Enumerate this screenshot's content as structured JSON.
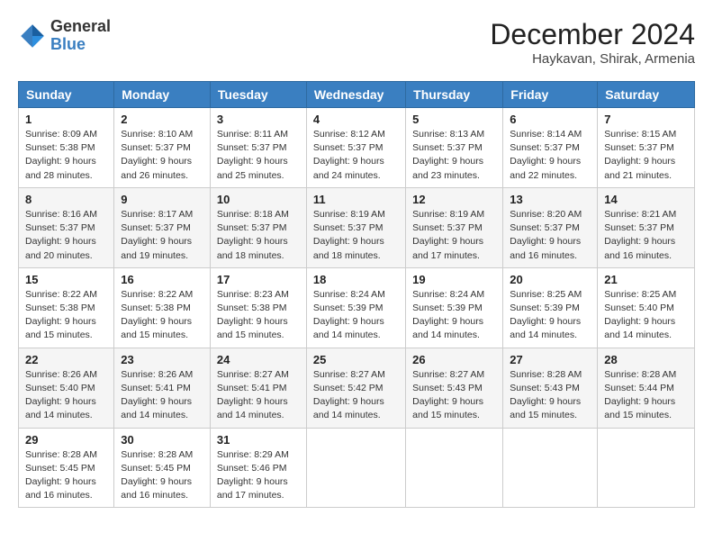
{
  "header": {
    "logo_general": "General",
    "logo_blue": "Blue",
    "month_title": "December 2024",
    "location": "Haykavan, Shirak, Armenia"
  },
  "weekdays": [
    "Sunday",
    "Monday",
    "Tuesday",
    "Wednesday",
    "Thursday",
    "Friday",
    "Saturday"
  ],
  "weeks": [
    [
      {
        "day": "1",
        "sunrise": "8:09 AM",
        "sunset": "5:38 PM",
        "daylight": "9 hours and 28 minutes."
      },
      {
        "day": "2",
        "sunrise": "8:10 AM",
        "sunset": "5:37 PM",
        "daylight": "9 hours and 26 minutes."
      },
      {
        "day": "3",
        "sunrise": "8:11 AM",
        "sunset": "5:37 PM",
        "daylight": "9 hours and 25 minutes."
      },
      {
        "day": "4",
        "sunrise": "8:12 AM",
        "sunset": "5:37 PM",
        "daylight": "9 hours and 24 minutes."
      },
      {
        "day": "5",
        "sunrise": "8:13 AM",
        "sunset": "5:37 PM",
        "daylight": "9 hours and 23 minutes."
      },
      {
        "day": "6",
        "sunrise": "8:14 AM",
        "sunset": "5:37 PM",
        "daylight": "9 hours and 22 minutes."
      },
      {
        "day": "7",
        "sunrise": "8:15 AM",
        "sunset": "5:37 PM",
        "daylight": "9 hours and 21 minutes."
      }
    ],
    [
      {
        "day": "8",
        "sunrise": "8:16 AM",
        "sunset": "5:37 PM",
        "daylight": "9 hours and 20 minutes."
      },
      {
        "day": "9",
        "sunrise": "8:17 AM",
        "sunset": "5:37 PM",
        "daylight": "9 hours and 19 minutes."
      },
      {
        "day": "10",
        "sunrise": "8:18 AM",
        "sunset": "5:37 PM",
        "daylight": "9 hours and 18 minutes."
      },
      {
        "day": "11",
        "sunrise": "8:19 AM",
        "sunset": "5:37 PM",
        "daylight": "9 hours and 18 minutes."
      },
      {
        "day": "12",
        "sunrise": "8:19 AM",
        "sunset": "5:37 PM",
        "daylight": "9 hours and 17 minutes."
      },
      {
        "day": "13",
        "sunrise": "8:20 AM",
        "sunset": "5:37 PM",
        "daylight": "9 hours and 16 minutes."
      },
      {
        "day": "14",
        "sunrise": "8:21 AM",
        "sunset": "5:37 PM",
        "daylight": "9 hours and 16 minutes."
      }
    ],
    [
      {
        "day": "15",
        "sunrise": "8:22 AM",
        "sunset": "5:38 PM",
        "daylight": "9 hours and 15 minutes."
      },
      {
        "day": "16",
        "sunrise": "8:22 AM",
        "sunset": "5:38 PM",
        "daylight": "9 hours and 15 minutes."
      },
      {
        "day": "17",
        "sunrise": "8:23 AM",
        "sunset": "5:38 PM",
        "daylight": "9 hours and 15 minutes."
      },
      {
        "day": "18",
        "sunrise": "8:24 AM",
        "sunset": "5:39 PM",
        "daylight": "9 hours and 14 minutes."
      },
      {
        "day": "19",
        "sunrise": "8:24 AM",
        "sunset": "5:39 PM",
        "daylight": "9 hours and 14 minutes."
      },
      {
        "day": "20",
        "sunrise": "8:25 AM",
        "sunset": "5:39 PM",
        "daylight": "9 hours and 14 minutes."
      },
      {
        "day": "21",
        "sunrise": "8:25 AM",
        "sunset": "5:40 PM",
        "daylight": "9 hours and 14 minutes."
      }
    ],
    [
      {
        "day": "22",
        "sunrise": "8:26 AM",
        "sunset": "5:40 PM",
        "daylight": "9 hours and 14 minutes."
      },
      {
        "day": "23",
        "sunrise": "8:26 AM",
        "sunset": "5:41 PM",
        "daylight": "9 hours and 14 minutes."
      },
      {
        "day": "24",
        "sunrise": "8:27 AM",
        "sunset": "5:41 PM",
        "daylight": "9 hours and 14 minutes."
      },
      {
        "day": "25",
        "sunrise": "8:27 AM",
        "sunset": "5:42 PM",
        "daylight": "9 hours and 14 minutes."
      },
      {
        "day": "26",
        "sunrise": "8:27 AM",
        "sunset": "5:43 PM",
        "daylight": "9 hours and 15 minutes."
      },
      {
        "day": "27",
        "sunrise": "8:28 AM",
        "sunset": "5:43 PM",
        "daylight": "9 hours and 15 minutes."
      },
      {
        "day": "28",
        "sunrise": "8:28 AM",
        "sunset": "5:44 PM",
        "daylight": "9 hours and 15 minutes."
      }
    ],
    [
      {
        "day": "29",
        "sunrise": "8:28 AM",
        "sunset": "5:45 PM",
        "daylight": "9 hours and 16 minutes."
      },
      {
        "day": "30",
        "sunrise": "8:28 AM",
        "sunset": "5:45 PM",
        "daylight": "9 hours and 16 minutes."
      },
      {
        "day": "31",
        "sunrise": "8:29 AM",
        "sunset": "5:46 PM",
        "daylight": "9 hours and 17 minutes."
      },
      null,
      null,
      null,
      null
    ]
  ],
  "labels": {
    "sunrise": "Sunrise:",
    "sunset": "Sunset:",
    "daylight": "Daylight:"
  }
}
